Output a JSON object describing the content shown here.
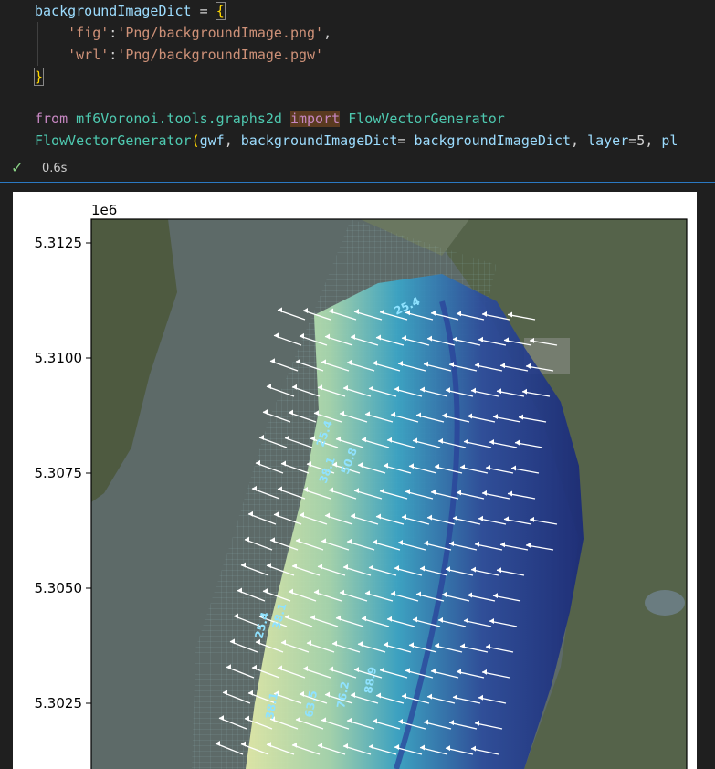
{
  "code": {
    "l1_var": "backgroundImageDict",
    "l1_eq": " = ",
    "l1_brace": "{",
    "l2_key": "'fig'",
    "l2_colon": ":",
    "l2_val": "'Png/backgroundImage.png'",
    "l2_comma": ",",
    "l3_key": "'wrl'",
    "l3_colon": ":",
    "l3_val": "'Png/backgroundImage.pgw'",
    "l4_brace": "}",
    "l5_from": "from",
    "l5_module": "mf6Voronoi.tools.graphs2d",
    "l5_import": "import",
    "l5_class": "FlowVectorGenerator",
    "l6_class": "FlowVectorGenerator",
    "l6_paren": "(",
    "l6_arg1": "gwf",
    "l6_sep1": ", ",
    "l6_kw": "backgroundImageDict",
    "l6_eq": "= ",
    "l6_arg2": "backgroundImageDict",
    "l6_sep2": ", ",
    "l6_kw2": "layer",
    "l6_eq2": "=5, ",
    "l6_tail": "pl"
  },
  "status": {
    "check_icon": "✓",
    "time": "0.6s"
  },
  "plot": {
    "offset_label": "1e6",
    "yticks": [
      "5.3125",
      "5.3100",
      "5.3075",
      "5.3050",
      "5.3025"
    ],
    "contour_labels": [
      "25.4",
      "25.4",
      "38.1",
      "50.8",
      "25.4",
      "38.1",
      "38.1",
      "63.5",
      "76.2",
      "88.9"
    ],
    "colors": {
      "water": "#5d6a68",
      "land": "#55634a",
      "low_head": "#e6eeaa",
      "mid_head": "#3aa6c8",
      "high_head": "#1a2a78",
      "contour": "#8fe2ff"
    }
  },
  "chart_data": {
    "type": "heatmap",
    "ylabel_offset": "1e6",
    "yticks": [
      5.3125,
      5.31,
      5.3075,
      5.305,
      5.3025
    ],
    "contour_levels": [
      25.4,
      38.1,
      50.8,
      63.5,
      76.2,
      88.9
    ],
    "overlays": [
      "background satellite image",
      "flow vectors"
    ]
  }
}
